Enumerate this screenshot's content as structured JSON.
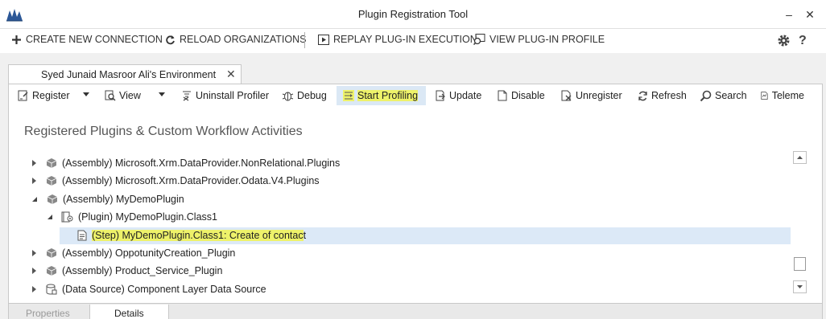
{
  "window": {
    "title": "Plugin Registration Tool",
    "minimize": "–",
    "close": "✕"
  },
  "command_bar": {
    "create_connection": "CREATE NEW CONNECTION",
    "reload_organizations": "RELOAD ORGANIZATIONS",
    "replay_execution": "REPLAY PLUG-IN EXECUTION",
    "view_profile": "VIEW PLUG-IN PROFILE",
    "help": "?"
  },
  "environment_tab": {
    "label": "Syed Junaid Masroor Ali's Environment",
    "close": "✕"
  },
  "toolbar": {
    "register": "Register",
    "view": "View",
    "uninstall_profiler": "Uninstall Profiler",
    "debug": "Debug",
    "start_profiling": "Start Profiling",
    "update": "Update",
    "disable": "Disable",
    "unregister": "Unregister",
    "refresh": "Refresh",
    "search": "Search",
    "telemetry": "Teleme"
  },
  "section": {
    "title": "Registered Plugins & Custom Workflow Activities"
  },
  "tree": [
    {
      "label": "(Assembly) Microsoft.Xrm.DataProvider.NonRelational.Plugins",
      "state": "collapsed",
      "icon": "assembly-icon"
    },
    {
      "label": "(Assembly) Microsoft.Xrm.DataProvider.Odata.V4.Plugins",
      "state": "collapsed",
      "icon": "assembly-icon"
    },
    {
      "label": "(Assembly) MyDemoPlugin",
      "state": "expanded",
      "icon": "assembly-icon"
    },
    {
      "label": "(Plugin) MyDemoPlugin.Class1",
      "state": "expanded",
      "icon": "plugin-icon"
    },
    {
      "label_highlighted": "(Step) MyDemoPlugin.Class1: Create of contac",
      "label_rest": "t",
      "state": "leaf",
      "icon": "step-icon",
      "selected": true
    },
    {
      "label": "(Assembly) OppotunityCreation_Plugin",
      "state": "collapsed",
      "icon": "assembly-icon"
    },
    {
      "label": "(Assembly) Product_Service_Plugin",
      "state": "collapsed",
      "icon": "assembly-icon"
    },
    {
      "label": "(Data Source) Component Layer Data Source",
      "state": "collapsed",
      "icon": "data-source-icon"
    }
  ],
  "bottom_tabs": {
    "properties": "Properties",
    "details": "Details"
  },
  "colors": {
    "highlight": "#eef26a",
    "selection": "#dce9f7",
    "toolbar_active": "#dbe8f5"
  }
}
